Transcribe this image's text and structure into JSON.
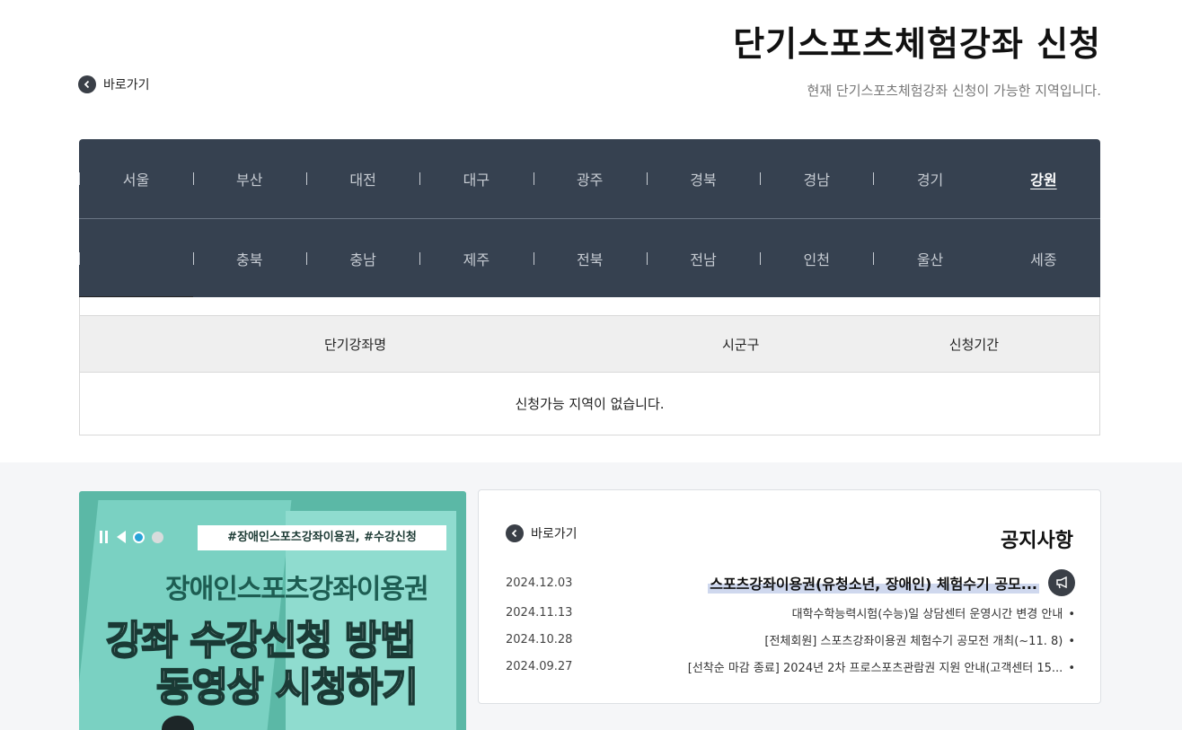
{
  "page": {
    "title": "단기스포츠체험강좌 신청",
    "subtitle": "현재 단기스포츠체험강좌 신청이 가능한 지역입니다.",
    "shortcut_label": "바로가기"
  },
  "regions": {
    "row1": [
      "강원",
      "경기",
      "경남",
      "경북",
      "광주",
      "대구",
      "대전",
      "부산",
      "서울"
    ],
    "row2": [
      "세종",
      "울산",
      "인천",
      "전남",
      "전북",
      "제주",
      "충남",
      "충북"
    ],
    "active": "강원"
  },
  "table": {
    "headers": [
      "신청기간",
      "시군구",
      "단기강좌명"
    ],
    "empty_message": "신청가능 지역이 없습니다."
  },
  "banner": {
    "tag": "#장애인스포츠강좌이용권, #수강신청",
    "line1": "장애인스포츠강좌이용권",
    "line2": "강좌 수강신청 방법",
    "line3": "동영상 시청하기",
    "controls": {
      "prev_icon": "prev-icon",
      "pause_icon": "pause-icon",
      "slide_count": 2,
      "active_slide": 1
    }
  },
  "notice": {
    "heading": "공지사항",
    "shortcut_label": "바로가기",
    "items": [
      {
        "title": "스포츠강좌이용권(유청소년, 장애인) 체험수기 공모...",
        "date": "2024.12.03",
        "featured": true
      },
      {
        "title": "대학수학능력시험(수능)일 상담센터 운영시간 변경 안내",
        "date": "2024.11.13",
        "featured": false
      },
      {
        "title": "[전체회원] 스포츠강좌이용권 체험수기 공모전 개최(~11. 8)",
        "date": "2024.10.28",
        "featured": false
      },
      {
        "title": "[선착순 마감 종료] 2024년 2차 프로스포츠관람권 지원 안내(고객센터 15...",
        "date": "2024.09.27",
        "featured": false
      }
    ]
  },
  "colors": {
    "region_bg": "#364150",
    "banner_bg": "#5bb8a6",
    "highlight": "#cfd8ee"
  }
}
